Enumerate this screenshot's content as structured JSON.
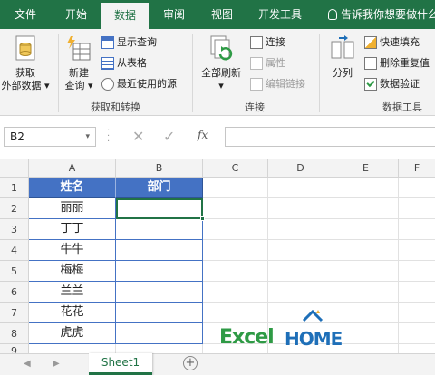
{
  "tabs": [
    "文件",
    "开始",
    "数据",
    "审阅",
    "视图",
    "开发工具"
  ],
  "active_tab": "数据",
  "tell_me": "告诉我你想要做什么",
  "ribbon": {
    "get_external_data": [
      "获取",
      "外部数据"
    ],
    "new_query": [
      "新建",
      "查询"
    ],
    "show_queries": "显示查询",
    "from_table": "从表格",
    "recent_sources": "最近使用的源",
    "group_get_transform": "获取和转换",
    "refresh_all": [
      "全部刷新"
    ],
    "connections": "连接",
    "properties": "属性",
    "edit_links": "编辑链接",
    "group_connections": "连接",
    "split": "分列",
    "flash_fill": "快速填充",
    "remove_duplicates": "删除重复值",
    "data_validation": "数据验证",
    "group_data_tools": "数据工具"
  },
  "formula_bar": {
    "name_box": "B2",
    "fx": "fx",
    "value": ""
  },
  "columns": [
    "A",
    "B",
    "C",
    "D",
    "E",
    "F"
  ],
  "rows": [
    "1",
    "2",
    "3",
    "4",
    "5",
    "6",
    "7",
    "8",
    "9"
  ],
  "table": {
    "header": [
      "姓名",
      "部门"
    ],
    "names": [
      "丽丽",
      "丁丁",
      "牛牛",
      "梅梅",
      "兰兰",
      "花花",
      "虎虎"
    ]
  },
  "logo": {
    "excel": "Excel",
    "home": "HOME"
  },
  "sheet": {
    "name": "Sheet1",
    "add": "+"
  },
  "colors": {
    "green": "#217346",
    "header_blue": "#4472c4",
    "logo_green": "#2e9a45",
    "logo_blue": "#1e6fb8"
  }
}
